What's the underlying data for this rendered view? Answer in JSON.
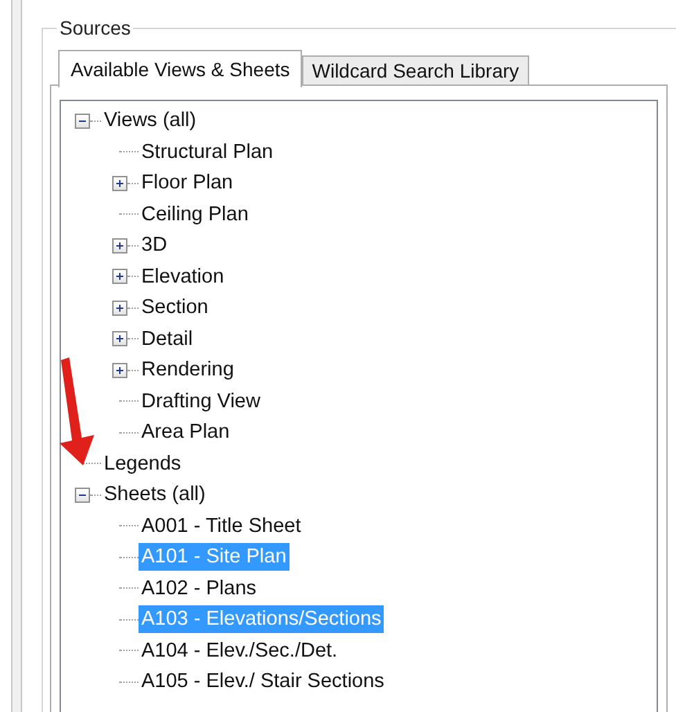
{
  "group": {
    "title": "Sources"
  },
  "tabs": [
    {
      "label": "Available Views & Sheets",
      "selected": true
    },
    {
      "label": "Wildcard Search Library",
      "selected": false
    }
  ],
  "tree": [
    {
      "label": "Views (all)",
      "expanded": true,
      "selected": false,
      "children": [
        {
          "label": "Structural Plan",
          "selected": false
        },
        {
          "label": "Floor Plan",
          "expanded": false,
          "selected": false
        },
        {
          "label": "Ceiling Plan",
          "selected": false
        },
        {
          "label": "3D",
          "expanded": false,
          "selected": false
        },
        {
          "label": "Elevation",
          "expanded": false,
          "selected": false
        },
        {
          "label": "Section",
          "expanded": false,
          "selected": false
        },
        {
          "label": "Detail",
          "expanded": false,
          "selected": false
        },
        {
          "label": "Rendering",
          "expanded": false,
          "selected": false
        },
        {
          "label": "Drafting View",
          "selected": false
        },
        {
          "label": "Area Plan",
          "selected": false
        }
      ]
    },
    {
      "label": "Legends",
      "selected": false
    },
    {
      "label": "Sheets (all)",
      "expanded": true,
      "selected": false,
      "children": [
        {
          "label": "A001 - Title Sheet",
          "selected": false
        },
        {
          "label": "A101 - Site Plan",
          "selected": true
        },
        {
          "label": "A102 - Plans",
          "selected": false
        },
        {
          "label": "A103 - Elevations/Sections",
          "selected": true
        },
        {
          "label": "A104 - Elev./Sec./Det.",
          "selected": false
        },
        {
          "label": "A105 - Elev./ Stair Sections",
          "selected": false
        }
      ]
    }
  ]
}
